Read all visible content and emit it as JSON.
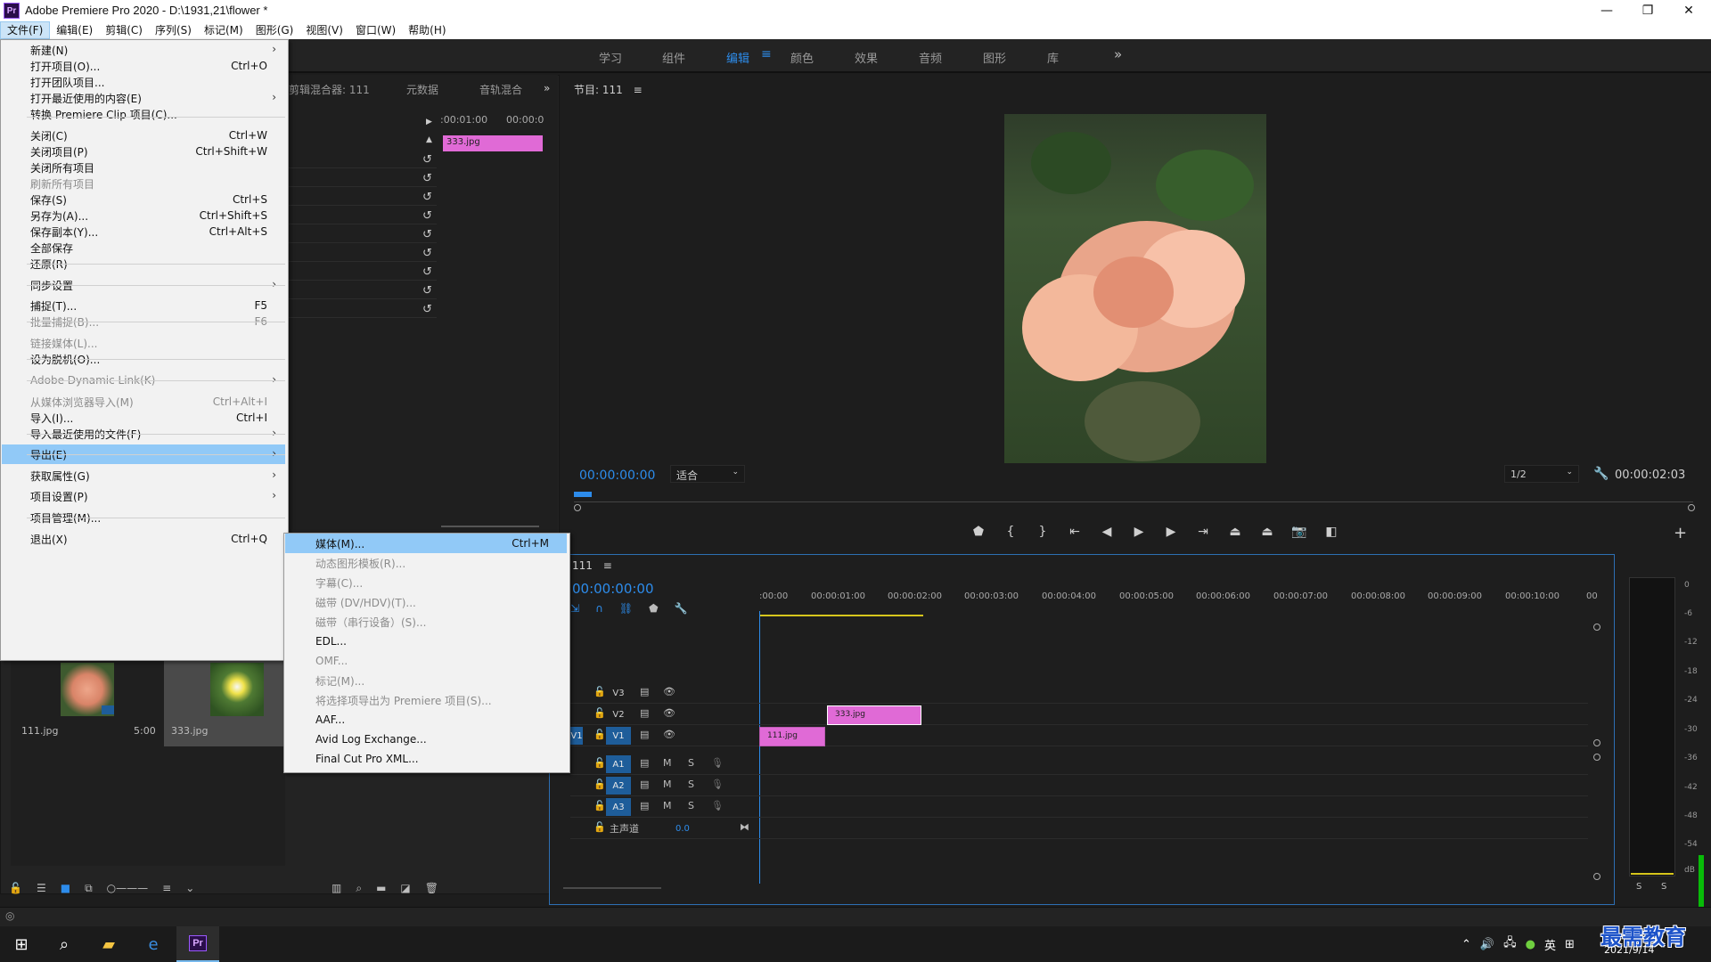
{
  "window": {
    "title": "Adobe Premiere Pro 2020 - D:\\1931,21\\flower *",
    "logo": "Pr",
    "minimize": "—",
    "restore": "❐",
    "close": "✕"
  },
  "menubar": [
    "文件(F)",
    "编辑(E)",
    "剪辑(C)",
    "序列(S)",
    "标记(M)",
    "图形(G)",
    "视图(V)",
    "窗口(W)",
    "帮助(H)"
  ],
  "workspaces": [
    "学习",
    "组件",
    "编辑",
    "颜色",
    "效果",
    "音频",
    "图形",
    "库"
  ],
  "workspace_more": "»",
  "source_panel": {
    "tabs": [
      "剪辑混合器: 111",
      "元数据",
      "音轨混合"
    ],
    "more": "»",
    "ruler_start": ":00:01:00",
    "ruler_end": "00:00:0",
    "clip": "333.jpg"
  },
  "program": {
    "title": "节目: 111",
    "menu_glyph": "≡",
    "timecode": "00:00:00:00",
    "fit": "适合",
    "resolution": "1/2",
    "duration": "00:00:02:03",
    "plus": "+"
  },
  "timeline": {
    "title": "111",
    "menu_glyph": "≡",
    "timecode": "00:00:00:00",
    "ticks": [
      ":00:00",
      "00:00:01:00",
      "00:00:02:00",
      "00:00:03:00",
      "00:00:04:00",
      "00:00:05:00",
      "00:00:06:00",
      "00:00:07:00",
      "00:00:08:00",
      "00:00:09:00",
      "00:00:10:00",
      "00"
    ],
    "tracks_video": [
      "V3",
      "V2",
      "V1"
    ],
    "tracks_audio": [
      "A1",
      "A2",
      "A3"
    ],
    "v1_target": "V1",
    "mute": "M",
    "solo": "S",
    "master_label": "主声道",
    "master_value": "0.0",
    "clip_v2": "333.jpg",
    "clip_v1": "111.jpg"
  },
  "meter": {
    "db_labels": [
      "0",
      "-6",
      "-12",
      "-18",
      "-24",
      "-30",
      "-36",
      "-42",
      "-48",
      "-54",
      "dB"
    ],
    "s": "S"
  },
  "bin": {
    "items": [
      {
        "name": "111.jpg",
        "duration": "5:00"
      },
      {
        "name": "333.jpg",
        "duration": ""
      }
    ]
  },
  "file_menu": {
    "items": [
      {
        "label": "新建(N)",
        "shortcut": "",
        "submenu": true,
        "disabled": false
      },
      {
        "label": "打开项目(O)...",
        "shortcut": "Ctrl+O",
        "submenu": false,
        "disabled": false
      },
      {
        "label": "打开团队项目...",
        "shortcut": "",
        "submenu": false,
        "disabled": false
      },
      {
        "label": "打开最近使用的内容(E)",
        "shortcut": "",
        "submenu": true,
        "disabled": false
      },
      {
        "label": "转换 Premiere Clip 项目(C)...",
        "shortcut": "",
        "submenu": false,
        "disabled": false
      },
      {
        "label": "关闭(C)",
        "shortcut": "Ctrl+W",
        "submenu": false,
        "disabled": false
      },
      {
        "label": "关闭项目(P)",
        "shortcut": "Ctrl+Shift+W",
        "submenu": false,
        "disabled": false
      },
      {
        "label": "关闭所有项目",
        "shortcut": "",
        "submenu": false,
        "disabled": false
      },
      {
        "label": "刷新所有项目",
        "shortcut": "",
        "submenu": false,
        "disabled": true
      },
      {
        "label": "保存(S)",
        "shortcut": "Ctrl+S",
        "submenu": false,
        "disabled": false
      },
      {
        "label": "另存为(A)...",
        "shortcut": "Ctrl+Shift+S",
        "submenu": false,
        "disabled": false
      },
      {
        "label": "保存副本(Y)...",
        "shortcut": "Ctrl+Alt+S",
        "submenu": false,
        "disabled": false
      },
      {
        "label": "全部保存",
        "shortcut": "",
        "submenu": false,
        "disabled": false
      },
      {
        "label": "还原(R)",
        "shortcut": "",
        "submenu": false,
        "disabled": false
      },
      {
        "label": "同步设置",
        "shortcut": "",
        "submenu": true,
        "disabled": false
      },
      {
        "label": "捕捉(T)...",
        "shortcut": "F5",
        "submenu": false,
        "disabled": false
      },
      {
        "label": "批量捕捉(B)...",
        "shortcut": "F6",
        "submenu": false,
        "disabled": true
      },
      {
        "label": "链接媒体(L)...",
        "shortcut": "",
        "submenu": false,
        "disabled": true
      },
      {
        "label": "设为脱机(O)...",
        "shortcut": "",
        "submenu": false,
        "disabled": false
      },
      {
        "label": "Adobe Dynamic Link(K)",
        "shortcut": "",
        "submenu": true,
        "disabled": true
      },
      {
        "label": "从媒体浏览器导入(M)",
        "shortcut": "Ctrl+Alt+I",
        "submenu": false,
        "disabled": true
      },
      {
        "label": "导入(I)...",
        "shortcut": "Ctrl+I",
        "submenu": false,
        "disabled": false
      },
      {
        "label": "导入最近使用的文件(F)",
        "shortcut": "",
        "submenu": true,
        "disabled": false
      },
      {
        "label": "导出(E)",
        "shortcut": "",
        "submenu": true,
        "disabled": false
      },
      {
        "label": "获取属性(G)",
        "shortcut": "",
        "submenu": true,
        "disabled": false
      },
      {
        "label": "项目设置(P)",
        "shortcut": "",
        "submenu": true,
        "disabled": false
      },
      {
        "label": "项目管理(M)...",
        "shortcut": "",
        "submenu": false,
        "disabled": false
      },
      {
        "label": "退出(X)",
        "shortcut": "Ctrl+Q",
        "submenu": false,
        "disabled": false
      }
    ]
  },
  "export_menu": {
    "items": [
      {
        "label": "媒体(M)...",
        "shortcut": "Ctrl+M",
        "disabled": false
      },
      {
        "label": "动态图形模板(R)...",
        "shortcut": "",
        "disabled": true
      },
      {
        "label": "字幕(C)...",
        "shortcut": "",
        "disabled": true
      },
      {
        "label": "磁带 (DV/HDV)(T)...",
        "shortcut": "",
        "disabled": true
      },
      {
        "label": "磁带（串行设备）(S)...",
        "shortcut": "",
        "disabled": true
      },
      {
        "label": "EDL...",
        "shortcut": "",
        "disabled": false
      },
      {
        "label": "OMF...",
        "shortcut": "",
        "disabled": true
      },
      {
        "label": "标记(M)...",
        "shortcut": "",
        "disabled": true
      },
      {
        "label": "将选择项导出为 Premiere 项目(S)...",
        "shortcut": "",
        "disabled": true
      },
      {
        "label": "AAF...",
        "shortcut": "",
        "disabled": false
      },
      {
        "label": "Avid Log Exchange...",
        "shortcut": "",
        "disabled": false
      },
      {
        "label": "Final Cut Pro XML...",
        "shortcut": "",
        "disabled": false
      }
    ]
  },
  "taskbar": {
    "ime": "英",
    "date": "2021/9/14"
  },
  "watermark": "最需教育",
  "colors": {
    "accent": "#2d8ceb",
    "clip": "#e06ad6",
    "menu_highlight": "#91c9f7"
  }
}
